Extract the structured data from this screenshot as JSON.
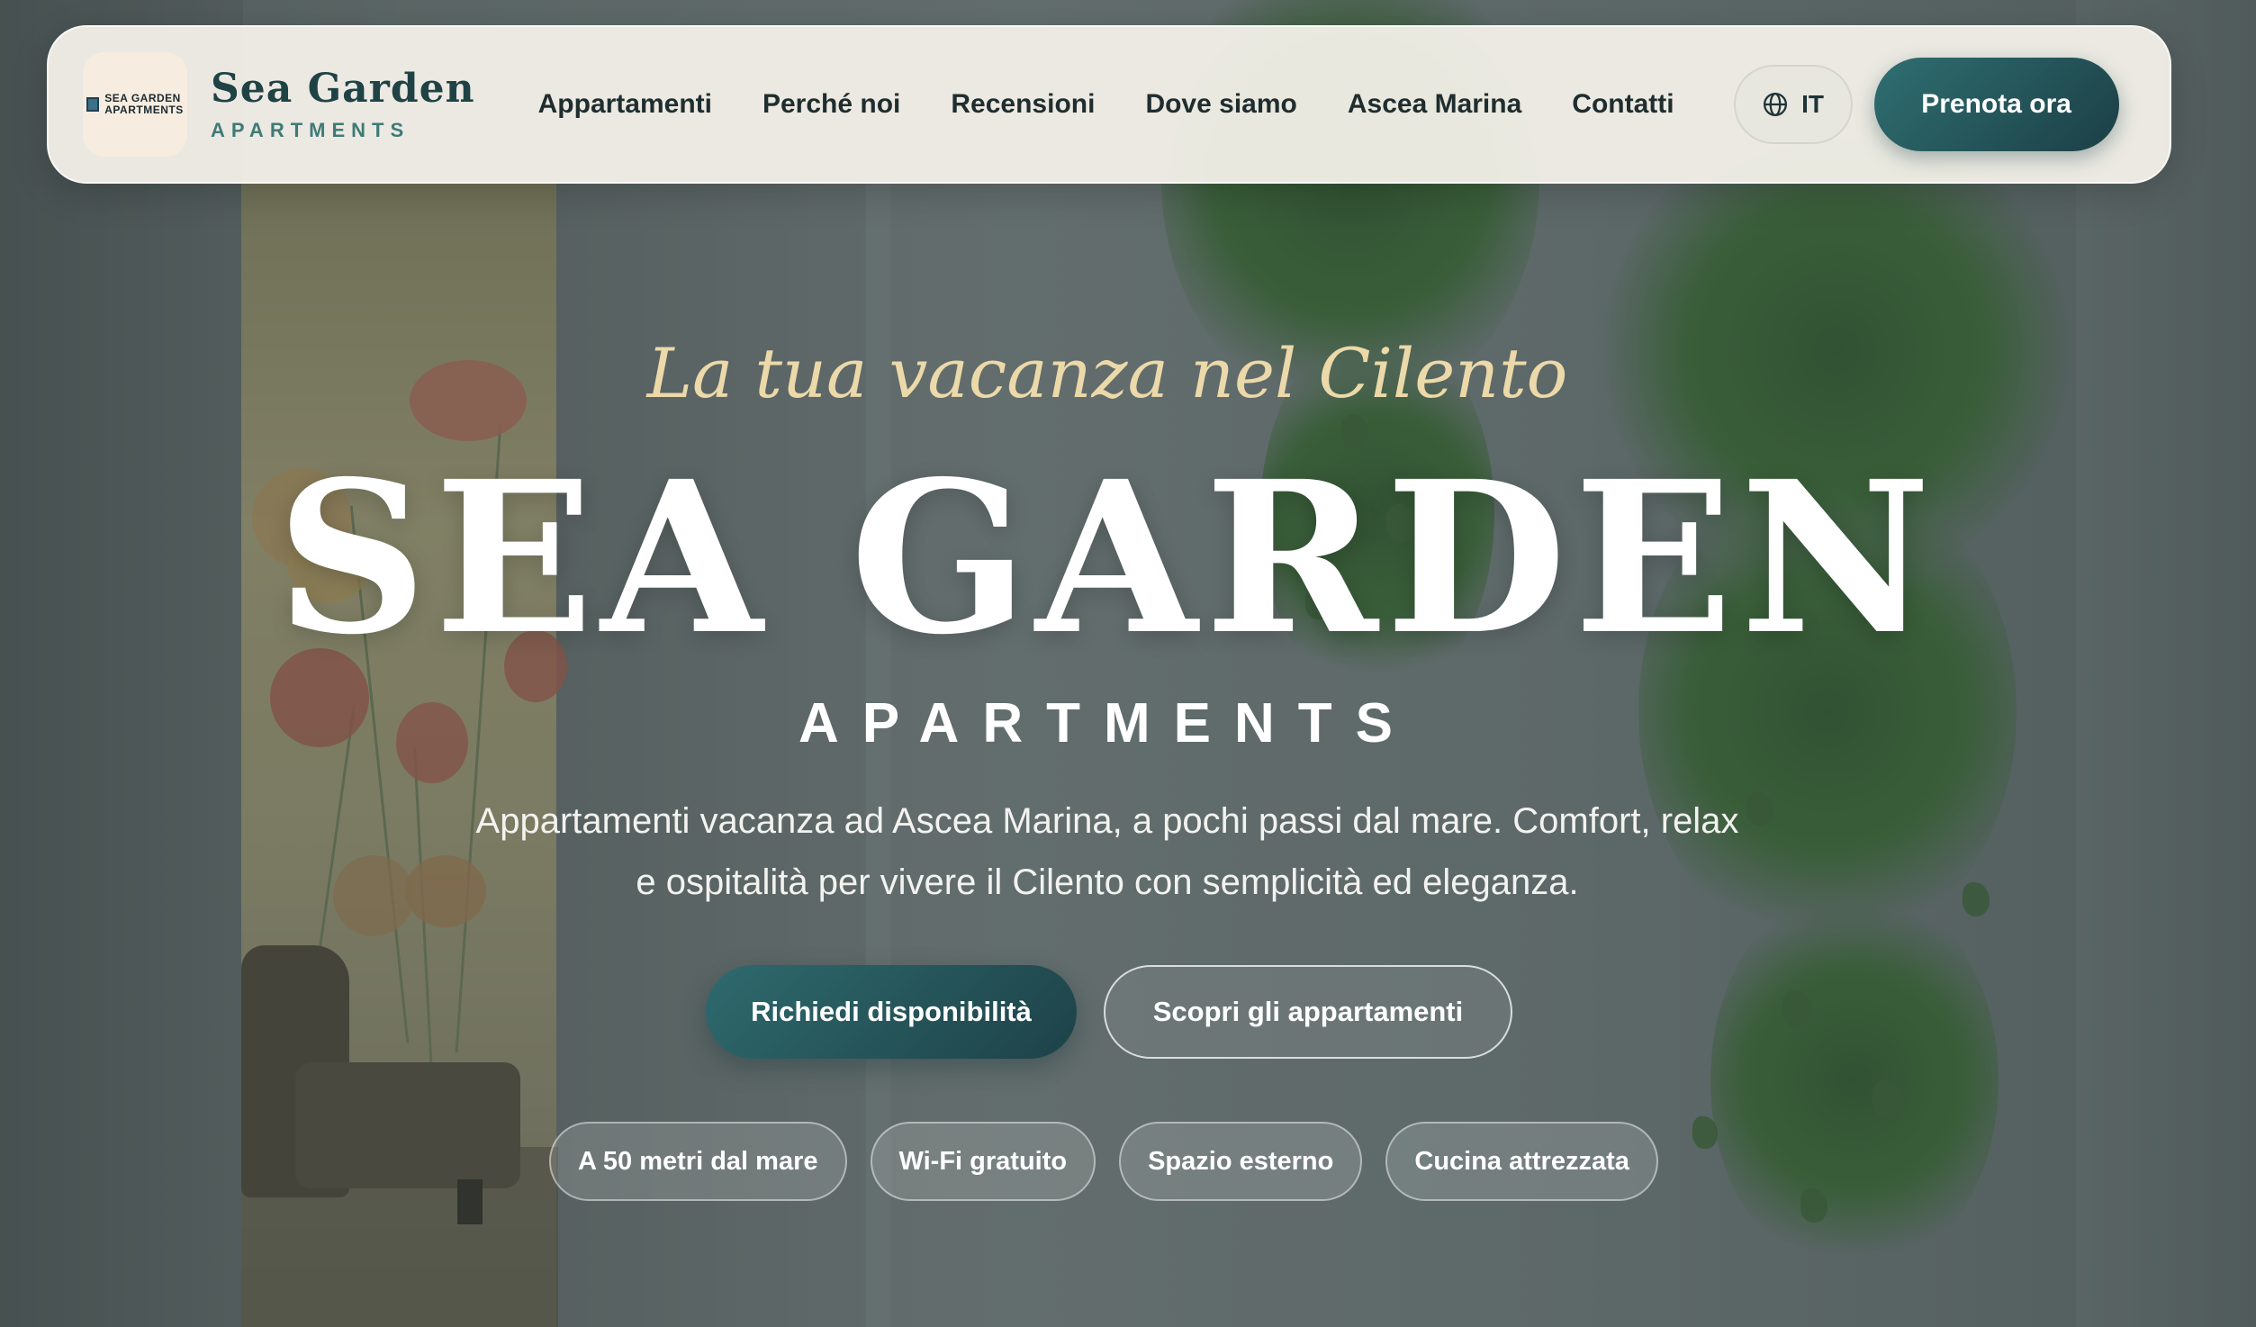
{
  "header": {
    "logo_line1": "SEA GARDEN",
    "logo_line2": "APARTMENTS",
    "brand_name": "Sea Garden",
    "brand_sub": "APARTMENTS",
    "nav": [
      {
        "label": "Appartamenti"
      },
      {
        "label": "Perché noi"
      },
      {
        "label": "Recensioni"
      },
      {
        "label": "Dove siamo"
      },
      {
        "label": "Ascea Marina"
      },
      {
        "label": "Contatti"
      }
    ],
    "language": "IT",
    "book_label": "Prenota ora"
  },
  "hero": {
    "tagline": "La tua vacanza nel Cilento",
    "title": "SEA GARDEN",
    "subtitle": "APARTMENTS",
    "description": "Appartamenti vacanza ad Ascea Marina, a pochi passi dal mare. Comfort, relax e ospitalità per vivere il Cilento con semplicità ed eleganza.",
    "cta_primary": "Richiedi disponibilità",
    "cta_secondary": "Scopri gli appartamenti",
    "features": [
      {
        "label": "A 50 metri dal mare"
      },
      {
        "label": "Wi-Fi gratuito"
      },
      {
        "label": "Spazio esterno"
      },
      {
        "label": "Cucina attrezzata"
      }
    ]
  },
  "colors": {
    "accent": "#1f4245",
    "brand_teal": "#3f7a76",
    "tagline_gold": "#ecd9a9",
    "button_teal": "#2e6a6e"
  },
  "icons": {
    "language": "globe-icon"
  }
}
